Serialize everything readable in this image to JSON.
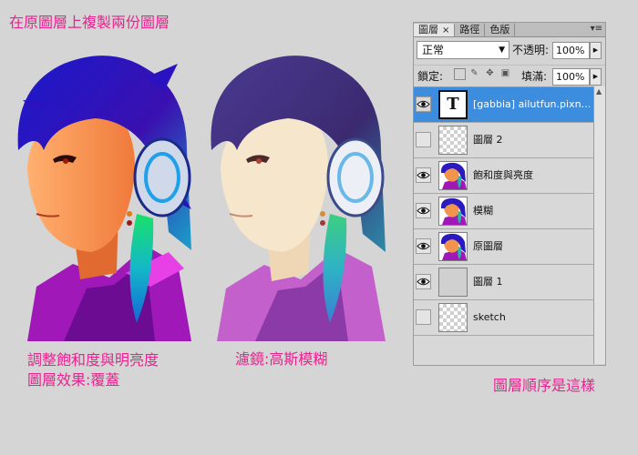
{
  "captions": {
    "top": "在原圖層上複製兩份圖層",
    "left_line1": "調整飽和度與明亮度",
    "left_line2": "圖層效果:覆蓋",
    "middle": "濾鏡:高斯模糊",
    "right": "圖層順序是這樣"
  },
  "panel": {
    "tabs": [
      "圖層",
      "路徑",
      "色版"
    ],
    "tab_close": "×",
    "menu_icon": "▾≡",
    "blend_mode": "正常",
    "opacity_label": "不透明:",
    "opacity_value": "100%",
    "lock_label": "鎖定:",
    "fill_label": "填滿:",
    "fill_value": "100%",
    "layers": [
      {
        "name": "[gabbia]  ailutfun.pixn…",
        "visible": true,
        "thumb": "text",
        "thumb_text": "T",
        "selected": true
      },
      {
        "name": "圖層 2",
        "visible": false,
        "thumb": "checker",
        "selected": false
      },
      {
        "name": "飽和度與亮度",
        "visible": true,
        "thumb": "portrait",
        "selected": false
      },
      {
        "name": "模糊",
        "visible": true,
        "thumb": "portrait",
        "selected": false
      },
      {
        "name": "原圖層",
        "visible": true,
        "thumb": "portrait",
        "selected": false
      },
      {
        "name": "圖層 1",
        "visible": true,
        "thumb": "solid",
        "selected": false
      },
      {
        "name": "sketch",
        "visible": false,
        "thumb": "checker",
        "selected": false
      }
    ]
  },
  "colors": {
    "caption": "#e8238f",
    "selection": "#3c8dde"
  }
}
